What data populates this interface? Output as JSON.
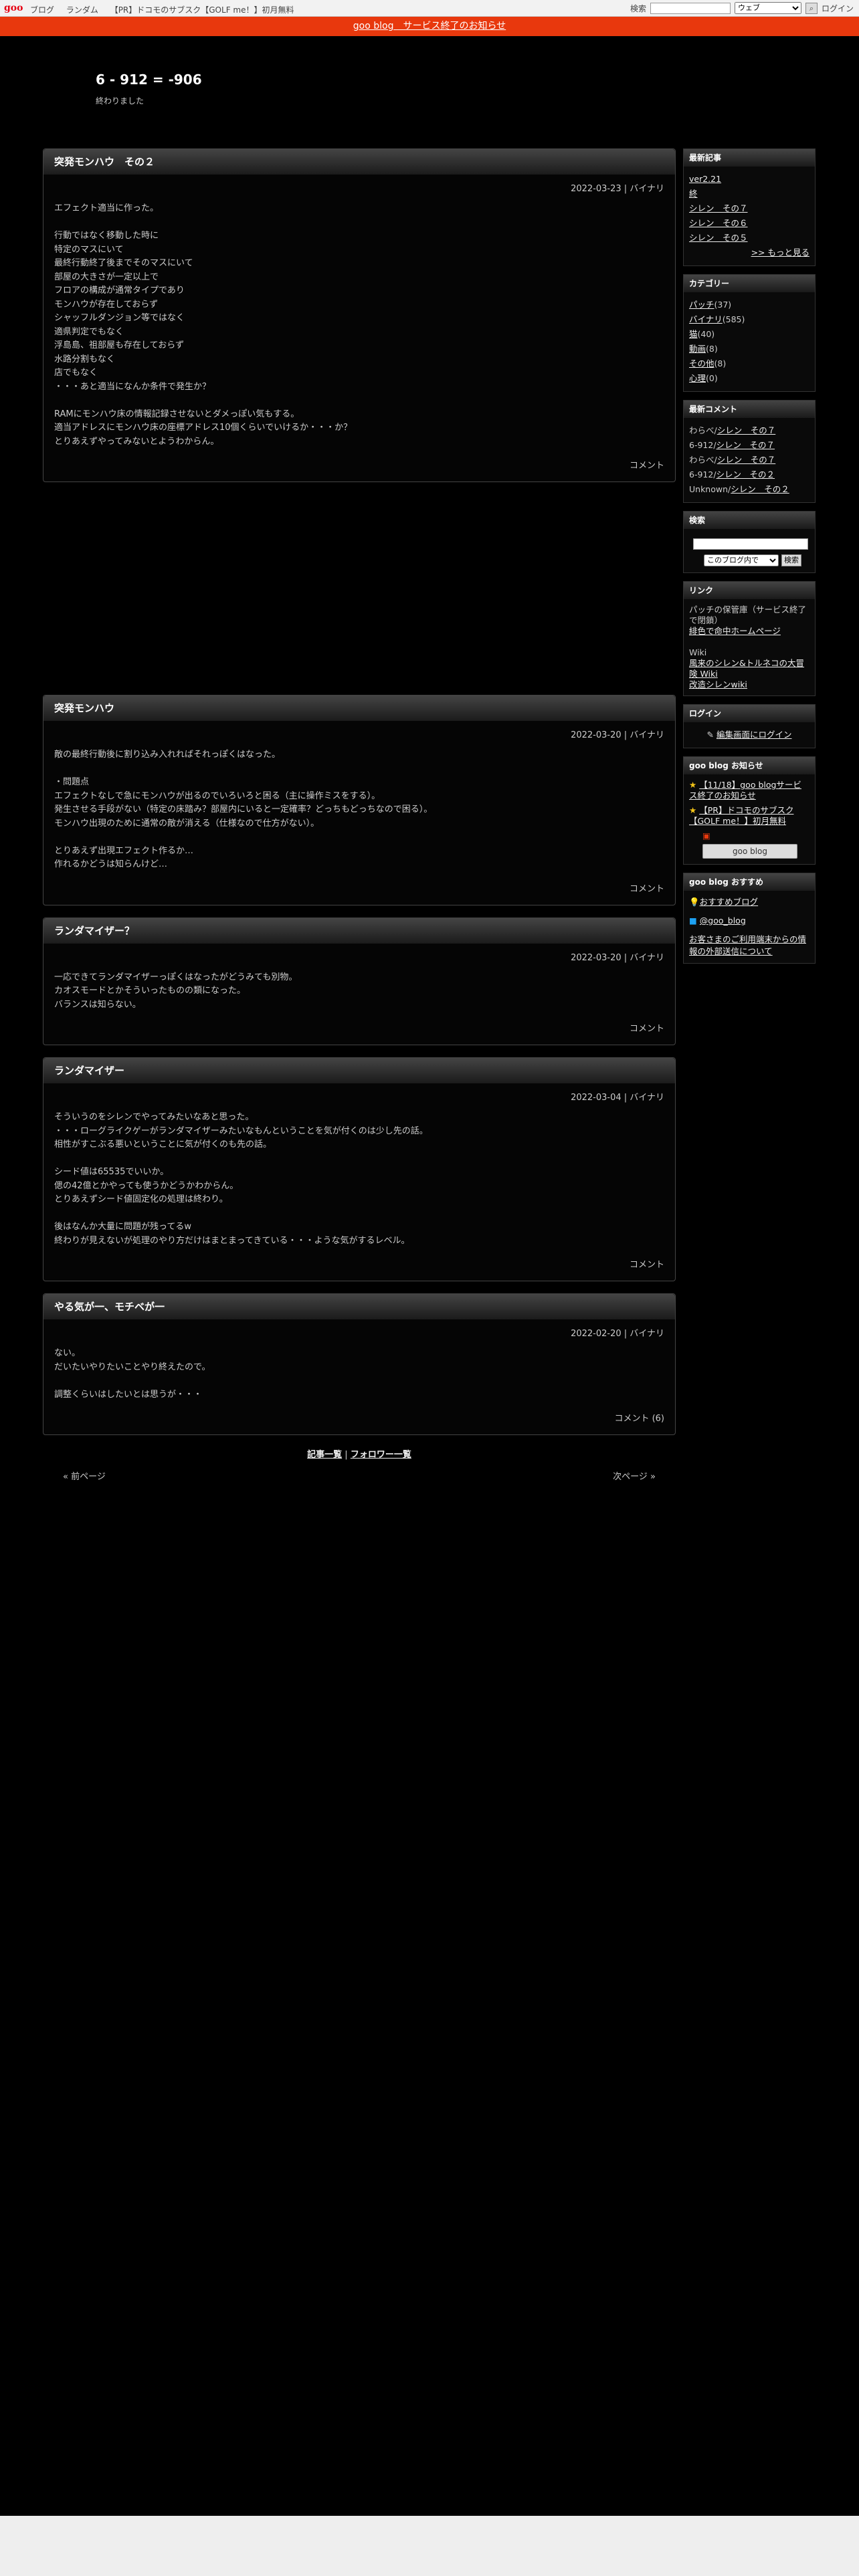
{
  "topbar": {
    "logo": "goo",
    "nav": [
      "ブログ",
      "ランダム",
      "【PR】ドコモのサブスク【GOLF me！】初月無料"
    ],
    "search_label": "検索",
    "search_select": "ウェブ",
    "login": "ログイン"
  },
  "notice": "goo blog　サービス終了のお知らせ",
  "header": {
    "title": "6 - 912 = -906",
    "desc": "終わりました"
  },
  "entries": [
    {
      "title": "突発モンハウ　その２",
      "meta": "2022-03-23 | バイナリ",
      "body": "エフェクト適当に作った。\n\n行動ではなく移動した時に\n特定のマスにいて\n最終行動終了後までそのマスにいて\n部屋の大きさが一定以上で\nフロアの構成が通常タイプであり\nモンハウが存在しておらず\nシャッフルダンジョン等ではなく\n適県判定でもなく\n浮島島、祖部屋も存在しておらず\n水路分割もなく\n店でもなく\n・・・あと適当になんか条件で発生か？\n\nRAMにモンハウ床の情報記録させないとダメっぽい気もする。\n適当アドレスにモンハウ床の座標アドレス10個くらいでいけるか・・・か？\nとりあえずやってみないとようわからん。",
      "foot": "コメント"
    },
    {
      "title": "突発モンハウ",
      "meta": "2022-03-20 | バイナリ",
      "body": "敵の最終行動後に割り込み入れればそれっぽくはなった。\n\n・問題点\nエフェクトなしで急にモンハウが出るのでいろいろと困る（主に操作ミスをする）。\n発生させる手段がない（特定の床踏み？部屋内にいると一定確率？どっちもどっちなので困る）。\nモンハウ出現のために通常の敵が消える（仕様なので仕方がない）。\n\nとりあえず出現エフェクト作るか…\n作れるかどうは知らんけど…",
      "foot": "コメント"
    },
    {
      "title": "ランダマイザー？",
      "meta": "2022-03-20 | バイナリ",
      "body": "一応できてランダマイザーっぽくはなったがどうみても別物。\nカオスモードとかそういったものの類になった。\nバランスは知らない。",
      "foot": "コメント"
    },
    {
      "title": "ランダマイザー",
      "meta": "2022-03-04 | バイナリ",
      "body": "そういうのをシレンでやってみたいなあと思った。\n・・・ローグライクゲーがランダマイザーみたいなもんということを気が付くのは少し先の話。\n相性がすこぶる悪いということに気が付くのも先の話。\n\nシード値は65535でいいか。\n偲の42億とかやっても使うかどうかわからん。\nとりあえずシード値固定化の処理は終わり。\n\n後はなんか大量に問題が残ってるw\n終わりが見えないが処理のやり方だけはまとまってきている・・・ような気がするレベル。",
      "foot": "コメント"
    },
    {
      "title": "やる気が一、モチベが一",
      "meta": "2022-02-20 | バイナリ",
      "body": "ない。\nだいたいやりたいことやり終えたので。\n\n調整くらいはしたいとは思うが・・・",
      "foot": "コメント (6)"
    }
  ],
  "pager": {
    "list": "記事一覧",
    "sep": " | ",
    "follow": "フォロワー一覧",
    "prev": "« 前ページ",
    "next": "次ページ »"
  },
  "sidebar": {
    "recent": {
      "title": "最新記事",
      "items": [
        "ver2.21",
        "終",
        "シレン　その７",
        "シレン　その６",
        "シレン　その５"
      ],
      "more": ">> もっと見る"
    },
    "category": {
      "title": "カテゴリー",
      "items": [
        [
          "パッチ",
          "(37)"
        ],
        [
          "バイナリ",
          "(585)"
        ],
        [
          "猫",
          "(40)"
        ],
        [
          "動画",
          "(8)"
        ],
        [
          "その他",
          "(8)"
        ],
        [
          "心理",
          "(0)"
        ]
      ]
    },
    "comments": {
      "title": "最新コメント",
      "items": [
        [
          "わらべ",
          "シレン　その７"
        ],
        [
          "6-912",
          "シレン　その７"
        ],
        [
          "わらべ",
          "シレン　その７"
        ],
        [
          "6-912",
          "シレン　その２"
        ],
        [
          "Unknown",
          "シレン　その２"
        ]
      ]
    },
    "search": {
      "title": "検索",
      "select": "このブログ内で",
      "button": "検索"
    },
    "links": {
      "title": "リンク",
      "lines": [
        "パッチの保管庫（サービス終了で閉鎖）",
        "",
        "Wiki"
      ],
      "link1": "緋色で命中ホームページ",
      "link2": "風来のシレン&トルネコの大冒険 Wiki",
      "link3": "改造シレンwiki"
    },
    "login": {
      "title": "ログイン",
      "label": "編集画面にログイン"
    },
    "goo_news": {
      "title": "goo blog お知らせ",
      "items": [
        "【11/18】goo blogサービス終了のお知らせ",
        "【PR】ドコモのサブスク【GOLF me！】初月無料"
      ],
      "logo": "goo blog"
    },
    "recommend": {
      "title": "goo blog おすすめ",
      "item": "おすすめブログ",
      "twitter": "@goo_blog",
      "notice": "お客さまのご利用端末からの情報の外部送信について"
    }
  }
}
